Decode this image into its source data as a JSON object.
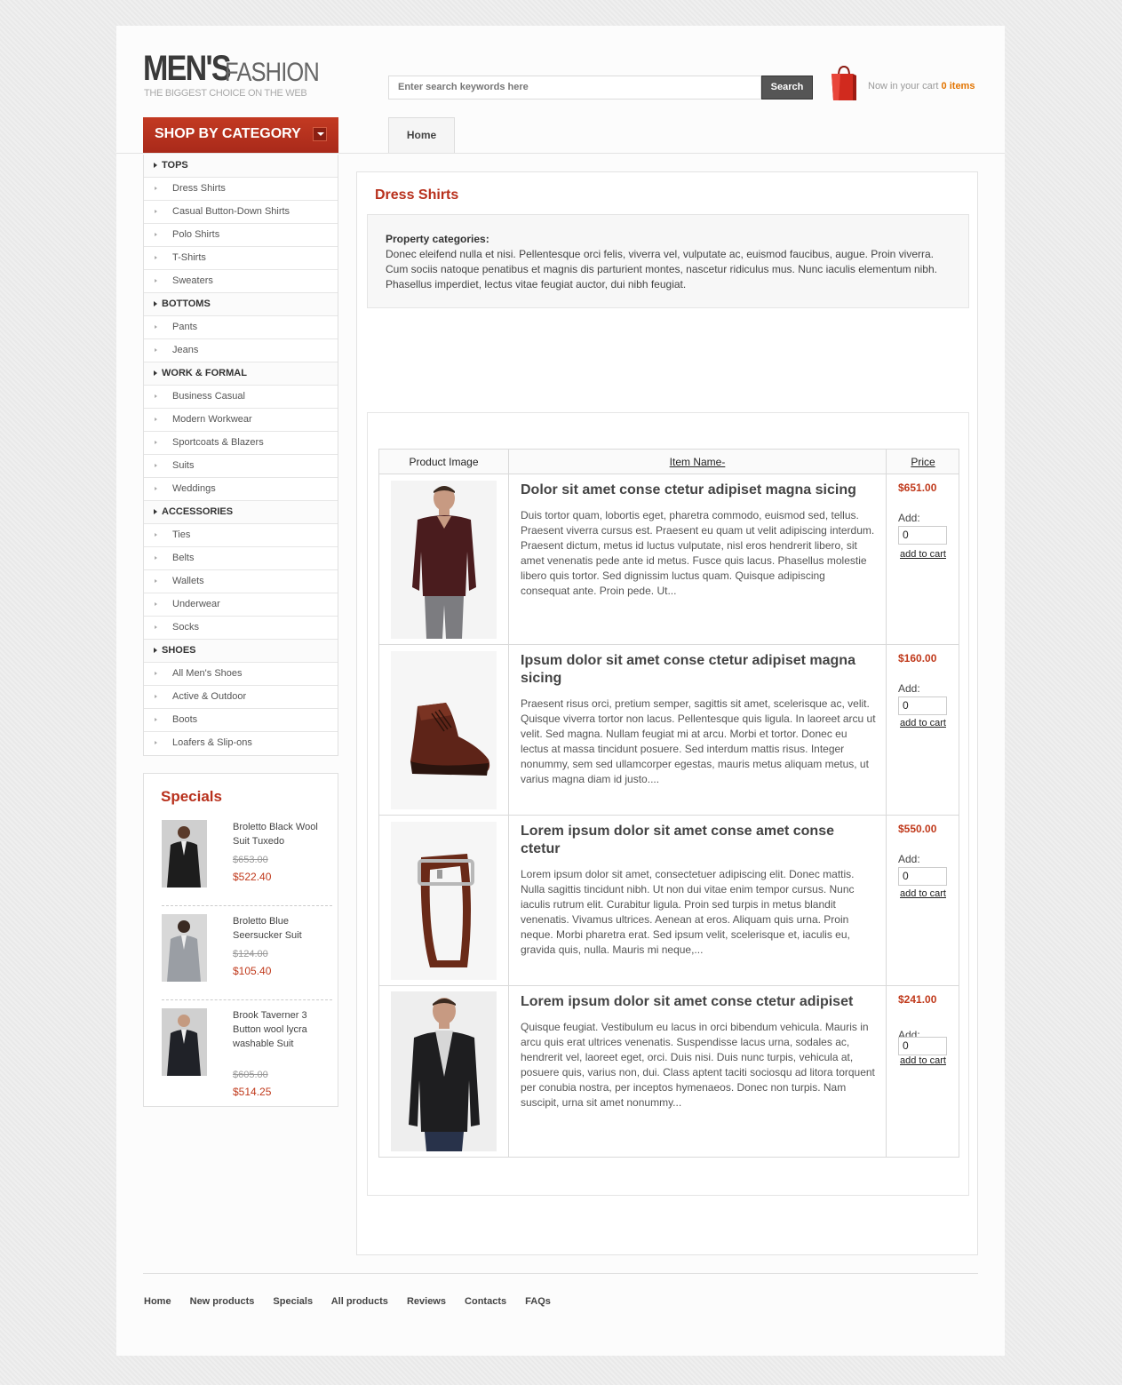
{
  "header": {
    "logo_mens": "MEN'S",
    "logo_fashion": "FASHION",
    "logo_tagline": "THE BIGGEST CHOICE ON THE WEB",
    "search_placeholder": "Enter search keywords here",
    "search_button": "Search",
    "cart_label": "Now in your cart",
    "cart_count": "0 items",
    "shop_by_category": "SHOP BY CATEGORY",
    "nav_home": "Home"
  },
  "categories": [
    {
      "label": "TOPS",
      "level": "top"
    },
    {
      "label": "Dress Shirts",
      "level": "sub"
    },
    {
      "label": "Casual Button-Down Shirts",
      "level": "sub"
    },
    {
      "label": "Polo Shirts",
      "level": "sub"
    },
    {
      "label": "T-Shirts",
      "level": "sub"
    },
    {
      "label": "Sweaters",
      "level": "sub"
    },
    {
      "label": "BOTTOMS",
      "level": "top"
    },
    {
      "label": "Pants",
      "level": "sub"
    },
    {
      "label": "Jeans",
      "level": "sub"
    },
    {
      "label": "WORK & FORMAL",
      "level": "top"
    },
    {
      "label": "Business Casual",
      "level": "sub"
    },
    {
      "label": "Modern Workwear",
      "level": "sub"
    },
    {
      "label": "Sportcoats & Blazers",
      "level": "sub"
    },
    {
      "label": "Suits",
      "level": "sub"
    },
    {
      "label": "Weddings",
      "level": "sub"
    },
    {
      "label": "ACCESSORIES",
      "level": "top"
    },
    {
      "label": "Ties",
      "level": "sub"
    },
    {
      "label": "Belts",
      "level": "sub"
    },
    {
      "label": "Wallets",
      "level": "sub"
    },
    {
      "label": "Underwear",
      "level": "sub"
    },
    {
      "label": "Socks",
      "level": "sub"
    },
    {
      "label": "SHOES",
      "level": "top"
    },
    {
      "label": "All Men's Shoes",
      "level": "sub"
    },
    {
      "label": "Active & Outdoor",
      "level": "sub"
    },
    {
      "label": "Boots",
      "level": "sub"
    },
    {
      "label": "Loafers & Slip-ons",
      "level": "sub"
    }
  ],
  "specials": {
    "title": "Specials",
    "items": [
      {
        "name": "Broletto Black Wool Suit Tuxedo",
        "old_price": "$653.00",
        "new_price": "$522.40"
      },
      {
        "name": "Broletto Blue Seersucker Suit",
        "old_price": "$124.00",
        "new_price": "$105.40"
      },
      {
        "name": "Brook Taverner 3 Button wool lycra washable Suit",
        "old_price": "$605.00",
        "new_price": "$514.25"
      }
    ]
  },
  "main": {
    "title": "Dress Shirts",
    "property_label": "Property categories:",
    "property_text": "Donec eleifend nulla et nisi. Pellentesque orci felis, viverra vel, vulputate ac, euismod faucibus, augue. Proin viverra. Cum sociis natoque penatibus et magnis dis parturient montes, nascetur ridiculus mus. Nunc iaculis elementum nibh. Phasellus imperdiet, lectus vitae feugiat auctor, dui nibh feugiat.",
    "table_headers": {
      "image": "Product Image",
      "name": "Item Name-",
      "price": "Price"
    },
    "products": [
      {
        "title": "Dolor sit amet conse ctetur adipiset magna sicing",
        "desc": "Duis tortor quam, lobortis eget, pharetra commodo, euismod sed, tellus. Praesent viverra cursus est. Praesent eu quam ut velit adipiscing interdum. Praesent dictum, metus id luctus vulputate, nisl eros hendrerit libero, sit amet venenatis pede ante id metus. Fusce quis lacus. Phasellus molestie libero quis tortor. Sed dignissim luctus quam. Quisque adipiscing consequat ante. Proin pede. Ut...",
        "price": "$651.00",
        "add_label": "Add:",
        "qty": "0",
        "cart_link": "add to cart",
        "icon": "sweater-icon"
      },
      {
        "title": "Ipsum dolor sit amet conse ctetur adipiset magna sicing",
        "desc": "Praesent risus orci, pretium semper, sagittis sit amet, scelerisque ac, velit. Quisque viverra tortor non lacus. Pellentesque quis ligula. In laoreet arcu ut velit. Sed magna. Nullam feugiat mi at arcu. Morbi et tortor. Donec eu lectus at massa tincidunt posuere. Sed interdum mattis risus. Integer nonummy, sem sed ullamcorper egestas, mauris metus aliquam metus, ut varius magna diam id justo....",
        "price": "$160.00",
        "add_label": "Add:",
        "qty": "0",
        "cart_link": "add to cart",
        "icon": "boot-icon"
      },
      {
        "title": "Lorem ipsum dolor sit amet conse amet conse ctetur",
        "desc": "Lorem ipsum dolor sit amet, consectetuer adipiscing elit. Donec mattis. Nulla sagittis tincidunt nibh. Ut non dui vitae enim tempor cursus. Nunc iaculis rutrum elit. Curabitur ligula. Proin sed turpis in metus blandit venenatis. Vivamus ultrices. Aenean at eros. Aliquam quis urna. Proin neque. Morbi pharetra erat. Sed ipsum velit, scelerisque et, iaculis eu, gravida quis, nulla. Mauris mi neque,...",
        "price": "$550.00",
        "add_label": "Add:",
        "qty": "0",
        "cart_link": "add to cart",
        "icon": "belt-icon"
      },
      {
        "title": "Lorem ipsum dolor sit amet conse ctetur adipiset",
        "desc": "Quisque feugiat. Vestibulum eu lacus in orci bibendum vehicula. Mauris in arcu quis erat ultrices venenatis. Suspendisse lacus urna, sodales ac, hendrerit vel, laoreet eget, orci. Duis nisi. Duis nunc turpis, vehicula at, posuere quis, varius non, dui. Class aptent taciti sociosqu ad litora torquent per conubia nostra, per inceptos hymenaeos. Donec non turpis. Nam suscipit, urna sit amet nonummy...",
        "price": "$241.00",
        "add_label": "Add:",
        "qty": "0",
        "cart_link": "add to cart",
        "icon": "blazer-icon"
      }
    ]
  },
  "footer": {
    "links": [
      "Home",
      "New products",
      "Specials",
      "All products",
      "Reviews",
      "Contacts",
      "FAQs"
    ]
  },
  "colors": {
    "accent": "#b8301c",
    "price": "#c0391b",
    "cart_count": "#e27400"
  }
}
